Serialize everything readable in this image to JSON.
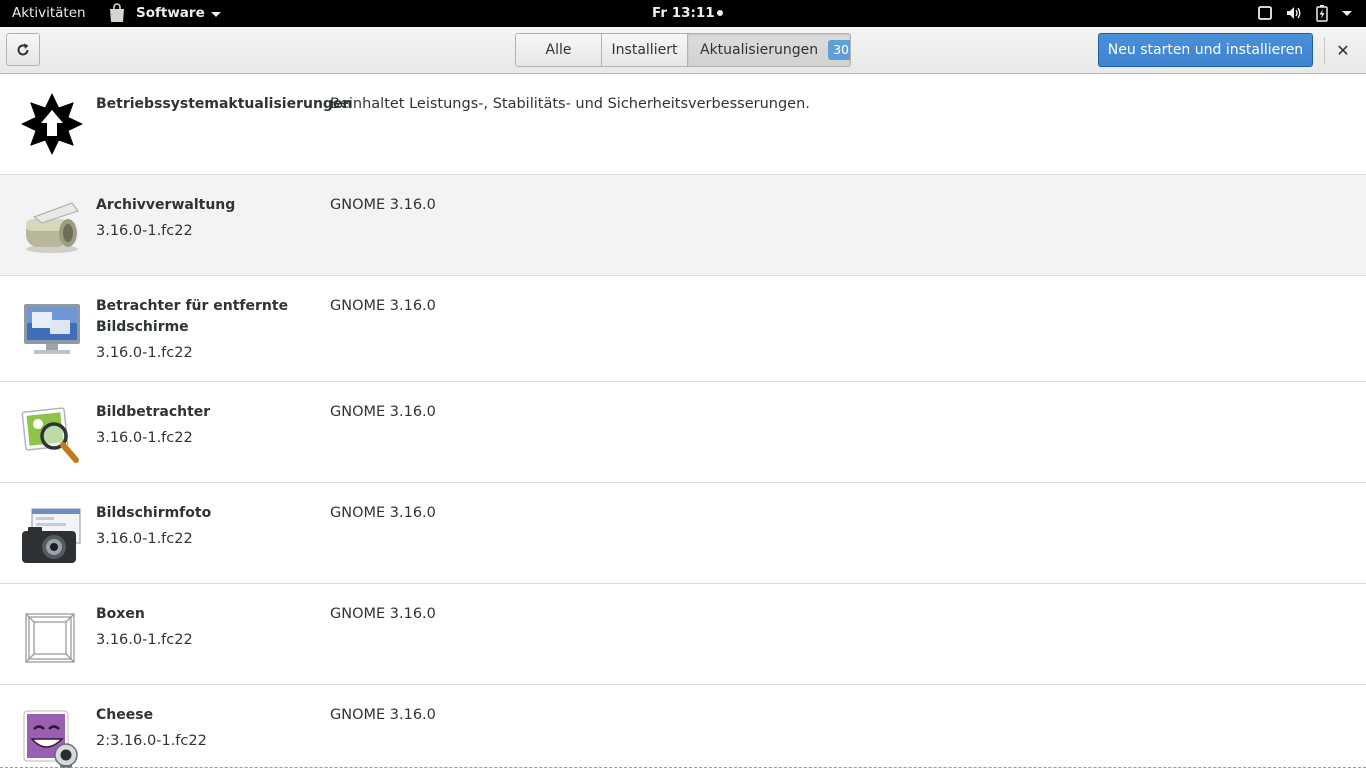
{
  "topbar": {
    "activities": "Aktivitäten",
    "app_name": "Software",
    "clock": "Fr 13:11"
  },
  "header": {
    "tabs": [
      {
        "label": "Alle"
      },
      {
        "label": "Installiert"
      },
      {
        "label": "Aktualisierungen",
        "badge": "30"
      }
    ],
    "install_button": "Neu starten und installieren",
    "close_glyph": "✕"
  },
  "updates": [
    {
      "name": "Betriebssystemaktualisierungen",
      "version": "",
      "description": "Beinhaltet Leistungs-, Stabilitäts- und Sicherheitsverbesserungen.",
      "icon": "os-update-icon"
    },
    {
      "name": "Archivverwaltung",
      "version": "3.16.0-1.fc22",
      "description": "GNOME 3.16.0",
      "icon": "archive-manager-icon"
    },
    {
      "name": "Betrachter für entfernte Bildschirme",
      "version": "3.16.0-1.fc22",
      "description": "GNOME 3.16.0",
      "icon": "remote-viewer-icon"
    },
    {
      "name": "Bildbetrachter",
      "version": "3.16.0-1.fc22",
      "description": "GNOME 3.16.0",
      "icon": "image-viewer-icon"
    },
    {
      "name": "Bildschirmfoto",
      "version": "3.16.0-1.fc22",
      "description": "GNOME 3.16.0",
      "icon": "screenshot-icon"
    },
    {
      "name": "Boxen",
      "version": "3.16.0-1.fc22",
      "description": "GNOME 3.16.0",
      "icon": "boxes-icon"
    },
    {
      "name": "Cheese",
      "version": "2:3.16.0-1.fc22",
      "description": "GNOME 3.16.0",
      "icon": "cheese-icon"
    }
  ]
}
